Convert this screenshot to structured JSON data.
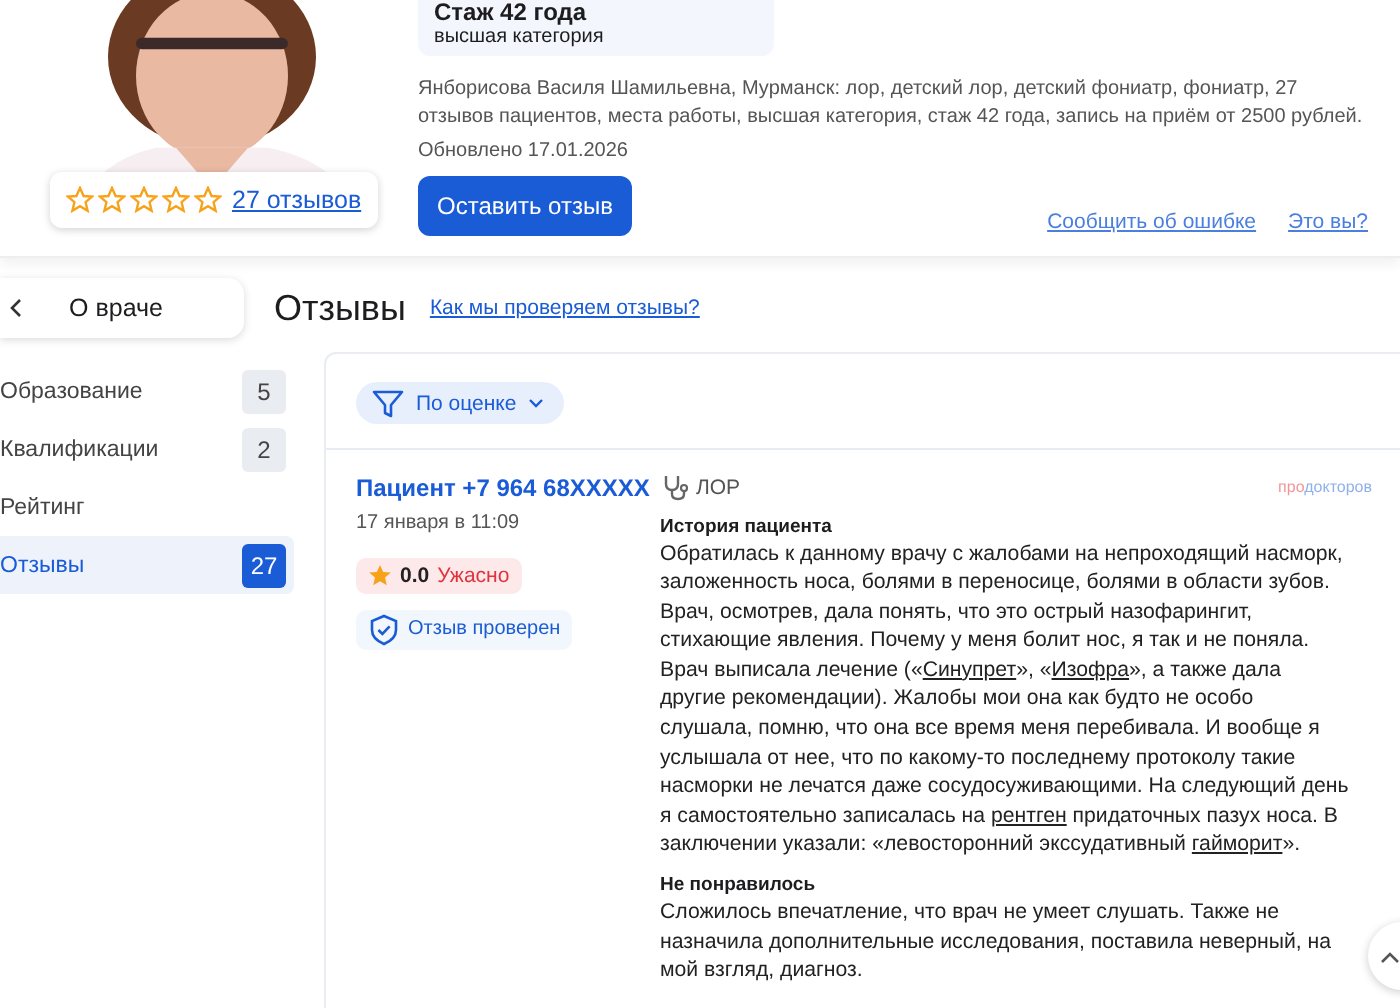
{
  "doctor": {
    "stars": 0,
    "reviews_link": "27 отзывов",
    "experience": "Стаж 42 года",
    "category": "высшая категория",
    "description": "Янборисова Василя Шамильевна, Мурманск: лор, детский лор, детский фониатр, фониатр, 27 отзывов пациентов, места работы, высшая категория, стаж 42 года, запись на приём от 2500 рублей.",
    "updated": "Обновлено 17.01.2026",
    "leave_review_button": "Оставить отзыв",
    "links": [
      "Сообщить об ошибке",
      "Это вы?"
    ]
  },
  "back_button": {
    "label": "О враче"
  },
  "sidebar": {
    "items": [
      {
        "label": "Образование",
        "count": "5",
        "selected": false
      },
      {
        "label": "Квалификации",
        "count": "2",
        "selected": false
      },
      {
        "label": "Рейтинг",
        "selected": false
      },
      {
        "label": "Отзывы",
        "count": "27",
        "selected": true
      }
    ]
  },
  "section": {
    "title": "Отзывы",
    "link": "Как мы проверяем отзывы?"
  },
  "filter": {
    "label": "По оценке"
  },
  "review": {
    "author": "Пациент +7 964 68XXXXX",
    "date": "17 января в 11:09",
    "rating": "0.0",
    "verdict": "Ужасно",
    "verified": "Отзыв проверен",
    "specialty": "ЛОР",
    "source_logo": [
      "про",
      "докторов"
    ],
    "sections": [
      {
        "heading": "История пациента",
        "parts": [
          {
            "kind": "text",
            "text": "Обратилась к данному врачу с жалобами на непроходящий насморк, заложенность носа, болями в переносице, болями в области зубов. Врач, осмотрев, дала понять, что это острый назофарингит, стихающие явления. Почему у меня болит нос, я так и не поняла. Врач выписала лечение («"
          },
          {
            "kind": "link",
            "text": "Синупрет"
          },
          {
            "kind": "text",
            "text": "», «"
          },
          {
            "kind": "link",
            "text": "Изофра"
          },
          {
            "kind": "text",
            "text": "», а также дала другие рекомендации). Жалобы мои она как будто не особо слушала, помню, что она все время меня перебивала. И вообще я услышала от нее, что по какому-то последнему протоколу такие насморки не лечатся даже сосудосуживающими. На следующий день я самостоятельно записалась на "
          },
          {
            "kind": "link",
            "text": "рентген"
          },
          {
            "kind": "text",
            "text": " придаточных пазух носа. В заключении указали: «левосторонний экссудативный "
          },
          {
            "kind": "link",
            "text": "гайморит"
          },
          {
            "kind": "text",
            "text": "»."
          }
        ]
      },
      {
        "heading": "Не понравилось",
        "parts": [
          {
            "kind": "text",
            "text": "Сложилось впечатление, что врач не умеет слушать. Также не назначила дополнительные исследования, поставила неверный, на мой взгляд, диагноз."
          }
        ]
      }
    ]
  }
}
